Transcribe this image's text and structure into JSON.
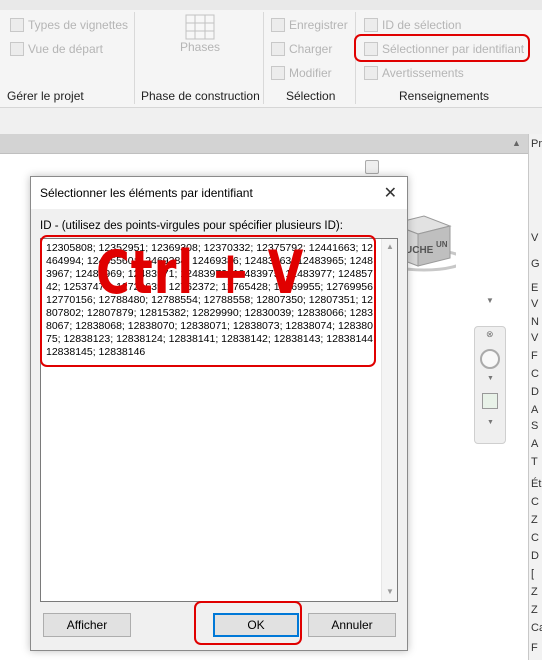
{
  "ribbon": {
    "manage_project": {
      "items": [
        "Types de vignettes",
        "Vue de départ"
      ],
      "title": "Gérer le projet"
    },
    "phasing": {
      "items": [
        "Phases"
      ],
      "title": "Phase de construction"
    },
    "selection": {
      "items": [
        "Enregistrer",
        "Charger",
        "Modifier"
      ],
      "title": "Sélection"
    },
    "inquiry": {
      "items": [
        "ID de sélection",
        "Sélectionner par identifiant",
        "Avertissements"
      ],
      "title": "Renseignements"
    }
  },
  "right_panel": {
    "header": "Pr",
    "letters": [
      "V",
      "G",
      "E",
      "V",
      "N",
      "V",
      "F",
      "C",
      "D",
      "A",
      "S",
      "A",
      "T",
      "Ét",
      "C",
      "Z",
      "C",
      "D",
      "[",
      "Z",
      "Z",
      "Ca",
      "F"
    ]
  },
  "view_cube": {
    "face_label": "UCHE",
    "face_label_2": "UN"
  },
  "dialog": {
    "title": "Sélectionner les éléments par identifiant",
    "close_glyph": "✕",
    "label": "ID - (utilisez des points-virgules pour spécifier plusieurs ID):",
    "ids": "12305808; 12352951; 12369308; 12370332; 12375792; 12441663; 12464994; 12465560; 12469384; 12469386; 12483963; 12483965; 12483967; 12483969; 12483971; 12483973; 12483975; 12483977; 12485742; 12537478; 12721639; 12762372; 12765428; 12769955; 12769956; 12770156; 12788480; 12788554; 12788558; 12807350; 12807351; 12807802; 12807879; 12815382; 12829990; 12830039; 12838066; 12838067; 12838068; 12838070; 12838071; 12838073; 12838074; 12838075; 12838123; 12838124; 12838141; 12838142; 12838143; 12838144; 12838145; 12838146",
    "buttons": {
      "show": "Afficher",
      "ok": "OK",
      "cancel": "Annuler"
    }
  },
  "annotation": {
    "text": "Ctrl + V",
    "color": "#e00000"
  }
}
